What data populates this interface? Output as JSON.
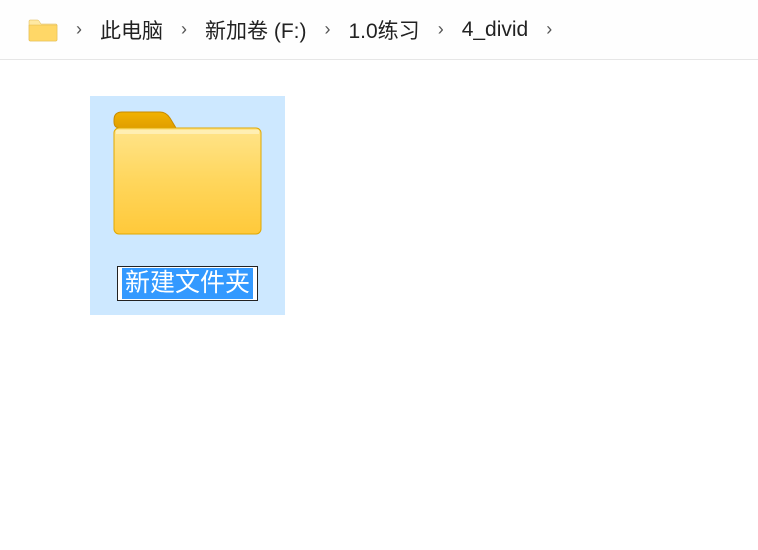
{
  "breadcrumb": {
    "separator": "›",
    "items": [
      {
        "label": "此电脑"
      },
      {
        "label": "新加卷 (F:)"
      },
      {
        "label": "1.0练习"
      },
      {
        "label": "4_divid"
      }
    ]
  },
  "content": {
    "items": [
      {
        "name": "新建文件夹",
        "type": "folder",
        "selected": true,
        "editing": true
      }
    ]
  },
  "icons": {
    "breadcrumb_folder": "folder-icon",
    "large_folder": "folder-icon"
  }
}
